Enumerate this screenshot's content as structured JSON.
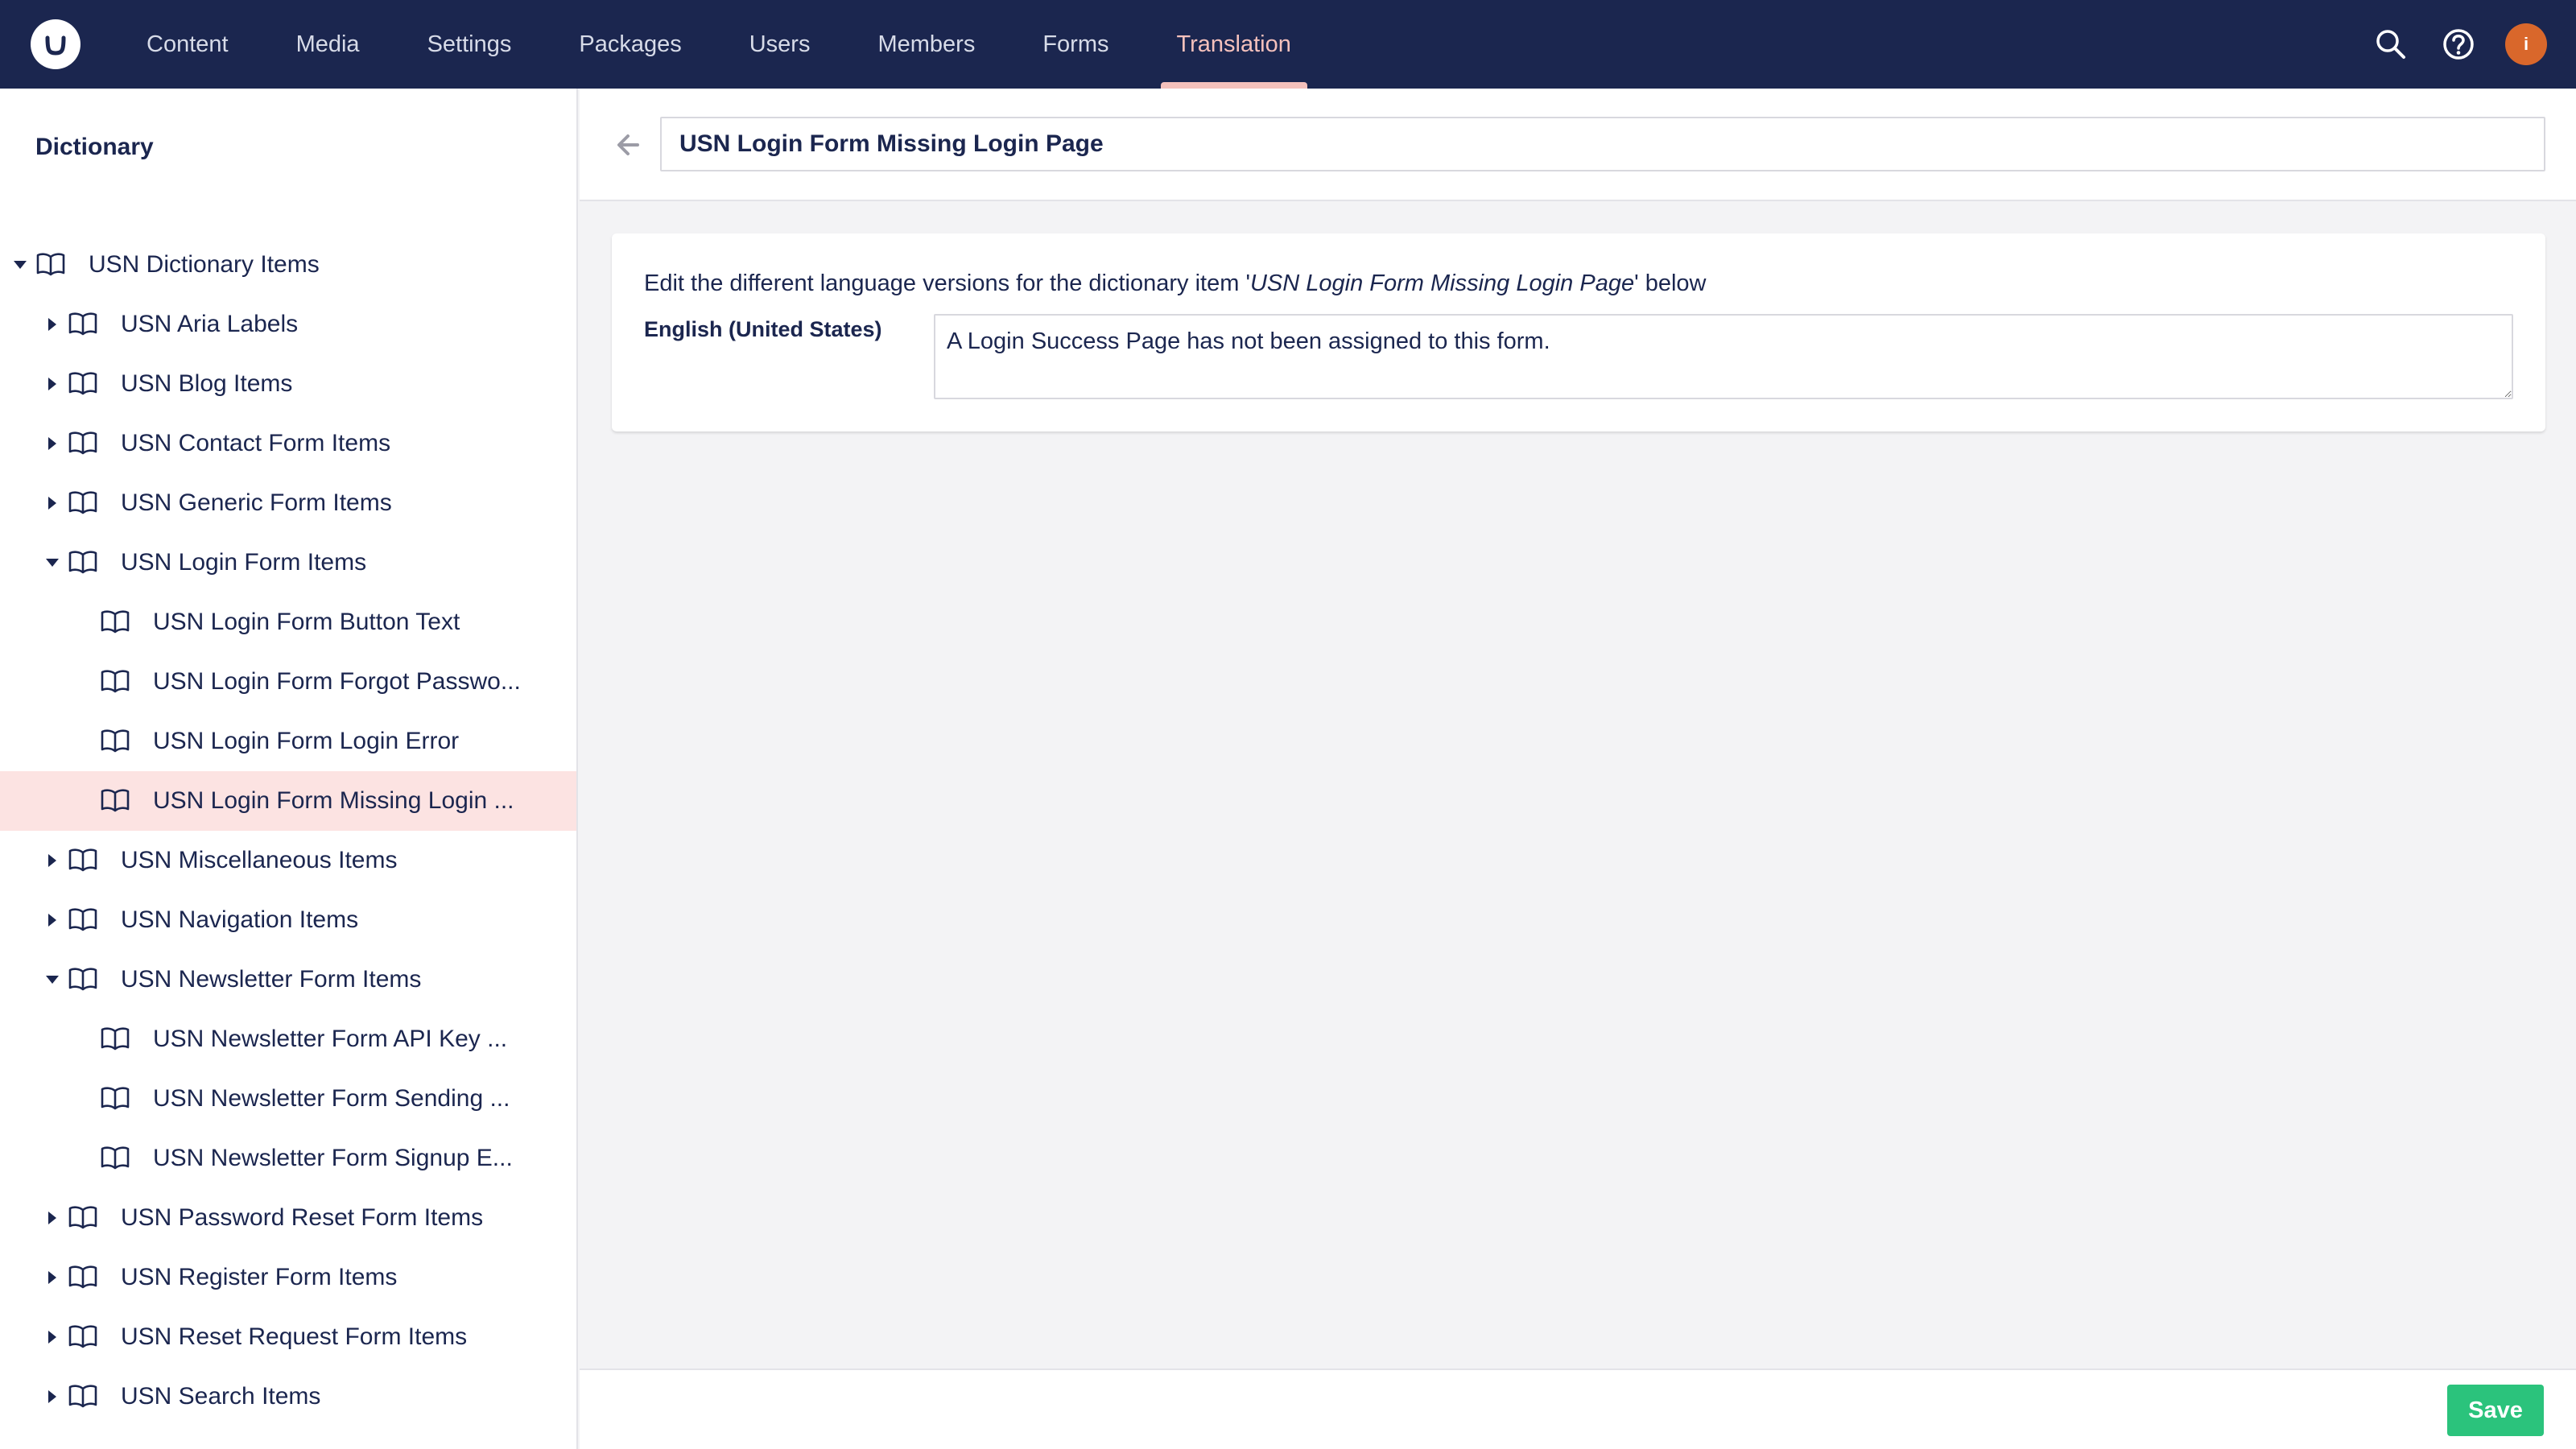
{
  "topbar": {
    "nav": [
      "Content",
      "Media",
      "Settings",
      "Packages",
      "Users",
      "Members",
      "Forms",
      "Translation"
    ],
    "active_nav": "Translation",
    "icons": [
      "search-icon",
      "help-icon"
    ],
    "avatar_initial": "i"
  },
  "sidebar": {
    "title": "Dictionary",
    "items": [
      {
        "label": "USN Dictionary Items",
        "level": 0,
        "caret": "down",
        "selected": false
      },
      {
        "label": "USN Aria Labels",
        "level": 1,
        "caret": "right",
        "selected": false
      },
      {
        "label": "USN Blog Items",
        "level": 1,
        "caret": "right",
        "selected": false
      },
      {
        "label": "USN Contact Form Items",
        "level": 1,
        "caret": "right",
        "selected": false
      },
      {
        "label": "USN Generic Form Items",
        "level": 1,
        "caret": "right",
        "selected": false
      },
      {
        "label": "USN Login Form Items",
        "level": 1,
        "caret": "down",
        "selected": false
      },
      {
        "label": "USN Login Form Button Text",
        "level": 2,
        "caret": "none",
        "selected": false
      },
      {
        "label": "USN Login Form Forgot Passwo...",
        "level": 2,
        "caret": "none",
        "selected": false
      },
      {
        "label": "USN Login Form Login Error",
        "level": 2,
        "caret": "none",
        "selected": false
      },
      {
        "label": "USN Login Form Missing Login ...",
        "level": 2,
        "caret": "none",
        "selected": true
      },
      {
        "label": "USN Miscellaneous Items",
        "level": 1,
        "caret": "right",
        "selected": false
      },
      {
        "label": "USN Navigation Items",
        "level": 1,
        "caret": "right",
        "selected": false
      },
      {
        "label": "USN Newsletter Form Items",
        "level": 1,
        "caret": "down",
        "selected": false
      },
      {
        "label": "USN Newsletter Form API Key ...",
        "level": 2,
        "caret": "none",
        "selected": false
      },
      {
        "label": "USN Newsletter Form Sending ...",
        "level": 2,
        "caret": "none",
        "selected": false
      },
      {
        "label": "USN Newsletter Form Signup E...",
        "level": 2,
        "caret": "none",
        "selected": false
      },
      {
        "label": "USN Password Reset Form Items",
        "level": 1,
        "caret": "right",
        "selected": false
      },
      {
        "label": "USN Register Form Items",
        "level": 1,
        "caret": "right",
        "selected": false
      },
      {
        "label": "USN Reset Request Form Items",
        "level": 1,
        "caret": "right",
        "selected": false
      },
      {
        "label": "USN Search Items",
        "level": 1,
        "caret": "right",
        "selected": false
      }
    ]
  },
  "main": {
    "item_name": "USN Login Form Missing Login Page",
    "description_prefix": "Edit the different language versions for the dictionary item '",
    "description_item": "USN Login Form Missing Login Page",
    "description_suffix": "' below",
    "language_label": "English (United States)",
    "language_value": "A Login Success Page has not been assigned to this form.",
    "save_label": "Save"
  },
  "colors": {
    "topbar": "#1b264f",
    "active_nav": "#f5c1bc",
    "selected_row": "#fce3e2",
    "save_button": "#2bc37c",
    "avatar": "#d9672b"
  }
}
